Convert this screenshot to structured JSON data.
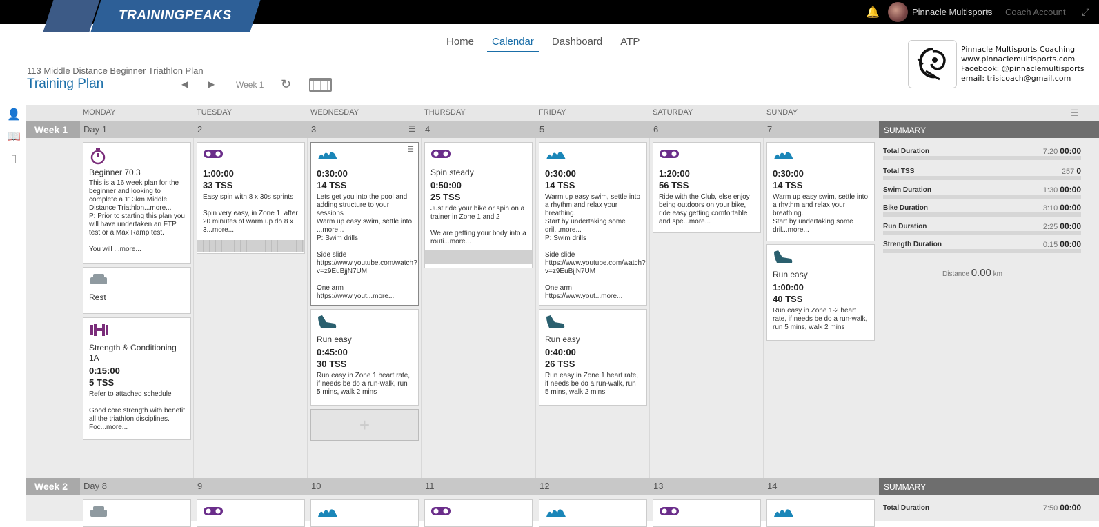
{
  "app": {
    "logo_text": "TRAININGPEAKS",
    "account_name": "Pinnacle Multisports",
    "coach_link": "Coach Account"
  },
  "nav": {
    "tabs": [
      "Home",
      "Calendar",
      "Dashboard",
      "ATP"
    ],
    "active": "Calendar"
  },
  "plan": {
    "subtitle": "113 Middle Distance Beginner Triathlon Plan",
    "title": "Training Plan",
    "week_label": "Week 1"
  },
  "coach": {
    "lines": [
      "Pinnacle Multisports Coaching",
      "www.pinnaclemultisports.com",
      "Facebook: @pinnaclemultisports",
      "email: trisicoach@gmail.com"
    ]
  },
  "days": [
    "MONDAY",
    "TUESDAY",
    "WEDNESDAY",
    "THURSDAY",
    "FRIDAY",
    "SATURDAY",
    "SUNDAY"
  ],
  "colors": {
    "bike": "#6a2d8a",
    "swim": "#1a86b8",
    "run": "#2a5f6e",
    "strength": "#7a2d7a",
    "rest": "#8f9aa0",
    "accent": "#1a6ea8"
  },
  "week1": {
    "label": "Week 1",
    "day_numbers": [
      "Day 1",
      "2",
      "3",
      "4",
      "5",
      "6",
      "7"
    ],
    "summary_title": "SUMMARY",
    "summary": [
      {
        "label": "Total Duration",
        "planned": "7:20",
        "completed": "00:00"
      },
      {
        "label": "Total TSS",
        "planned": "257",
        "completed": "0"
      },
      {
        "label": "Swim Duration",
        "planned": "1:30",
        "completed": "00:00"
      },
      {
        "label": "Bike Duration",
        "planned": "3:10",
        "completed": "00:00"
      },
      {
        "label": "Run Duration",
        "planned": "2:25",
        "completed": "00:00"
      },
      {
        "label": "Strength Duration",
        "planned": "0:15",
        "completed": "00:00"
      }
    ],
    "distance_label": "Distance",
    "distance_value": "0.00",
    "distance_unit": "km",
    "cards": {
      "mon1": {
        "title": "Beginner 70.3",
        "desc": "This is a 16 week plan for the beginner and looking to complete a 113km Middle Distance Triathlon...more...\nP: Prior to starting this plan you will have undertaken an FTP test or a Max Ramp test.\n\nYou will ...more..."
      },
      "mon2": {
        "title": "Rest"
      },
      "mon3": {
        "title": "Strength & Conditioning 1A",
        "duration": "0:15:00",
        "tss": "5",
        "tss_unit": "TSS",
        "desc": "Refer to attached schedule\n\nGood core strength with benefit all the triathlon disciplines. Foc...more..."
      },
      "tue1": {
        "duration": "1:00:00",
        "tss": "33",
        "tss_unit": "TSS",
        "desc": "Easy spin with 8 x 30s sprints\n\nSpin very easy, in Zone 1, after 20 minutes of warm up do 8 x 3...more..."
      },
      "wed1": {
        "duration": "0:30:00",
        "tss": "14",
        "tss_unit": "TSS",
        "desc": "Lets get you into the pool and adding structure to your sessions\nWarm up easy swim, settle into ...more...\nP: Swim drills\n\nSide slide\nhttps://www.youtube.com/watch?v=z9EuBjjN7UM\n\nOne arm\nhttps://www.yout...more..."
      },
      "wed2": {
        "title": "Run easy",
        "duration": "0:45:00",
        "tss": "30",
        "tss_unit": "TSS",
        "desc": "Run easy in Zone 1 heart rate, if needs be do a run-walk, run 5 mins, walk 2 mins"
      },
      "thu1": {
        "title": "Spin steady",
        "duration": "0:50:00",
        "tss": "25",
        "tss_unit": "TSS",
        "desc": "Just ride your bike or spin on a trainer in Zone 1 and 2\n\nWe are getting your body into a routi...more..."
      },
      "fri1": {
        "duration": "0:30:00",
        "tss": "14",
        "tss_unit": "TSS",
        "desc": "Warm up easy swim, settle into a rhythm and relax your breathing.\nStart by undertaking some dril...more...\nP: Swim drills\n\nSide slide\nhttps://www.youtube.com/watch?v=z9EuBjjN7UM\n\nOne arm\nhttps://www.yout...more..."
      },
      "fri2": {
        "title": "Run easy",
        "duration": "0:40:00",
        "tss": "26",
        "tss_unit": "TSS",
        "desc": "Run easy in Zone 1 heart rate, if needs be do a run-walk, run 5 mins, walk 2 mins"
      },
      "sat1": {
        "duration": "1:20:00",
        "tss": "56",
        "tss_unit": "TSS",
        "desc": "Ride with the Club, else enjoy being outdoors on your bike, ride easy getting comfortable and spe...more..."
      },
      "sun1": {
        "duration": "0:30:00",
        "tss": "14",
        "tss_unit": "TSS",
        "desc": "Warm up easy swim, settle into a rhythm and relax your breathing.\nStart by undertaking some dril...more..."
      },
      "sun2": {
        "title": "Run easy",
        "duration": "1:00:00",
        "tss": "40",
        "tss_unit": "TSS",
        "desc": "Run easy in Zone 1-2 heart rate, if needs be do a run-walk, run 5 mins, walk 2 mins"
      }
    }
  },
  "week2": {
    "label": "Week 2",
    "day_numbers": [
      "Day 8",
      "9",
      "10",
      "11",
      "12",
      "13",
      "14"
    ],
    "summary_title": "SUMMARY",
    "summary": [
      {
        "label": "Total Duration",
        "planned": "7:50",
        "completed": "00:00"
      }
    ]
  }
}
